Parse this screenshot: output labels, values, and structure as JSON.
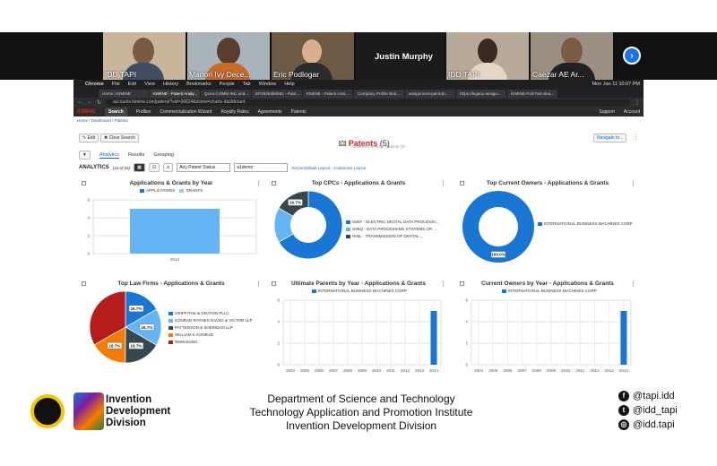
{
  "meeting": {
    "participants": [
      {
        "name": "IDD TAPI"
      },
      {
        "name": "Marion Ivy Dece..."
      },
      {
        "name": "Eric Podlogar"
      },
      {
        "name": "Justin Murphy"
      },
      {
        "name": "IDD TAPI"
      },
      {
        "name": "Caezar AE Ar..."
      }
    ],
    "next_icon": "chevron-right-icon"
  },
  "macbar": {
    "app": "Chrome",
    "menus": [
      "File",
      "Edit",
      "View",
      "History",
      "Bookmarks",
      "People",
      "Tab",
      "Window",
      "Help"
    ],
    "clock": "Mon Jan 11  10:07 PM"
  },
  "browser": {
    "tabs": [
      "Home | KIMINE",
      "KIMINE - Patent Analy...",
      "QUALCOMM INC and...",
      "EP2929390061 - Pate...",
      "KIMINE - Patent Assi...",
      "Company Profile Buil...",
      "assignment-pat-540...",
      "https://legacy-assign...",
      "KIMINE-Full-Text-Sea..."
    ],
    "url": "accounts.kimine.com/patent/?sid=26624&dview=charts-dashboard"
  },
  "appnav": {
    "logo": "KIMINE",
    "items": [
      "Search",
      "Profiles",
      "Commercialization Wizard",
      "Royalty Rates",
      "Agreements",
      "Patents"
    ],
    "right": [
      "Support",
      "Account"
    ]
  },
  "page": {
    "breadcrumb": "Home / Dashboard / Patents",
    "edit": "Edit",
    "clear_search": "Clear Search",
    "title": "Patents",
    "count": "(5)",
    "subtitle": "Advanced Search: Patents (5)",
    "navigate": "Navigate to...",
    "subtabs": [
      "Analytics",
      "Results",
      "Grouping"
    ],
    "analytics_label": "ANALYTICS",
    "analytics_range": "(10 of 54)",
    "status_select": "Any Patent Status",
    "layout_select": "a1demo",
    "set_default": "Set as Default Layout",
    "customize": "Customize Layout"
  },
  "charts": {
    "apps_grants": {
      "title": "Applications & Grants by Year",
      "legend": [
        "APPLICATIONS",
        "GRANTS"
      ],
      "yticks": [
        "6",
        "4",
        "2",
        "0"
      ],
      "xcat": "2014"
    },
    "cpcs": {
      "title": "Top CPCs - Applications & Grants",
      "pct": "16.7%",
      "legend": [
        "G06F - ELECTRIC DIGITAL DATA PROCESSI...",
        "G06Q - DATA PROCESSING SYSTEMS OR ...",
        "H04L - TRANSMISSION OF DIGITAL ..."
      ]
    },
    "owners": {
      "title": "Top Current Owners - Applications & Grants",
      "pct": "100.0%",
      "legend": [
        "INTERNATIONAL BUSINESS MACHINES CORP"
      ]
    },
    "lawfirms": {
      "title": "Top Law Firms - Applications & Grants",
      "pct": "16.7%",
      "legend": [
        "GRIFFITHS & GRATON PLLC",
        "KONRAD RAYNES DAVDA & VICTOR LLP",
        "PATTERSON & SHERIDAN LLP",
        "WILLIAM K KONRAD",
        "REMAINING"
      ]
    },
    "parents": {
      "title": "Ultimate Parents by Year - Applications & Grants",
      "legend": [
        "INTERNATIONAL BUSINESS MACHINES CORP"
      ]
    },
    "owners_year": {
      "title": "Current Owners by Year - Applications & Grants",
      "legend": [
        "INTERNATIONAL BUSINESS MACHINES CORP"
      ],
      "yticks": [
        "6",
        "4",
        "2",
        "0"
      ]
    },
    "years": [
      "2004",
      "2005",
      "2006",
      "2007",
      "2008",
      "2009",
      "2010",
      "2011",
      "2012",
      "2013",
      "2014"
    ]
  },
  "chart_data": [
    {
      "type": "bar",
      "title": "Applications & Grants by Year",
      "categories": [
        "2014"
      ],
      "series": [
        {
          "name": "APPLICATIONS",
          "values": [
            5
          ]
        },
        {
          "name": "GRANTS",
          "values": [
            0
          ]
        }
      ],
      "ylim": [
        0,
        6
      ]
    },
    {
      "type": "pie",
      "title": "Top CPCs - Applications & Grants",
      "labels": [
        "G06F - ELECTRIC DIGITAL DATA PROCESSI...",
        "G06Q - DATA PROCESSING SYSTEMS OR ...",
        "H04L - TRANSMISSION OF DIGITAL ..."
      ],
      "values": [
        66.6,
        16.7,
        16.7
      ]
    },
    {
      "type": "pie",
      "title": "Top Current Owners - Applications & Grants",
      "labels": [
        "INTERNATIONAL BUSINESS MACHINES CORP"
      ],
      "values": [
        100.0
      ]
    },
    {
      "type": "pie",
      "title": "Top Law Firms - Applications & Grants",
      "labels": [
        "GRIFFITHS & GRATON PLLC",
        "KONRAD RAYNES DAVDA & VICTOR LLP",
        "PATTERSON & SHERIDAN LLP",
        "WILLIAM K KONRAD",
        "REMAINING"
      ],
      "values": [
        16.7,
        16.7,
        16.7,
        16.7,
        33.2
      ]
    },
    {
      "type": "bar",
      "title": "Ultimate Parents by Year - Applications & Grants",
      "categories": [
        "2004",
        "2005",
        "2006",
        "2007",
        "2008",
        "2009",
        "2010",
        "2011",
        "2012",
        "2013",
        "2014"
      ],
      "series": [
        {
          "name": "INTERNATIONAL BUSINESS MACHINES CORP",
          "values": [
            0,
            0,
            0,
            0,
            0,
            0,
            0,
            0,
            0,
            0,
            5
          ]
        }
      ],
      "ylim": [
        0,
        6
      ]
    },
    {
      "type": "bar",
      "title": "Current Owners by Year - Applications & Grants",
      "categories": [
        "2004",
        "2005",
        "2006",
        "2007",
        "2008",
        "2009",
        "2010",
        "2011",
        "2012",
        "2013",
        "2014"
      ],
      "series": [
        {
          "name": "INTERNATIONAL BUSINESS MACHINES CORP",
          "values": [
            0,
            0,
            0,
            0,
            0,
            0,
            0,
            0,
            0,
            0,
            5
          ]
        }
      ],
      "ylim": [
        0,
        6
      ]
    }
  ],
  "footer": {
    "org_lines": [
      "Invention",
      "Development",
      "Division"
    ],
    "dept_lines": [
      "Department of Science and Technology",
      "Technology Application and Promotion Institute",
      "Invention Development Division"
    ],
    "social": [
      {
        "icon": "facebook-icon",
        "glyph": "f",
        "handle": "@tapi.idd"
      },
      {
        "icon": "twitter-icon",
        "glyph": "t",
        "handle": "@idd_tapi"
      },
      {
        "icon": "instagram-icon",
        "glyph": "◎",
        "handle": "@idd.tapi"
      }
    ]
  },
  "colors": {
    "blue": "#1976d2",
    "lightblue": "#64b5f6",
    "dark": "#37474f",
    "orange": "#f57c00",
    "red": "#b71c1c"
  }
}
